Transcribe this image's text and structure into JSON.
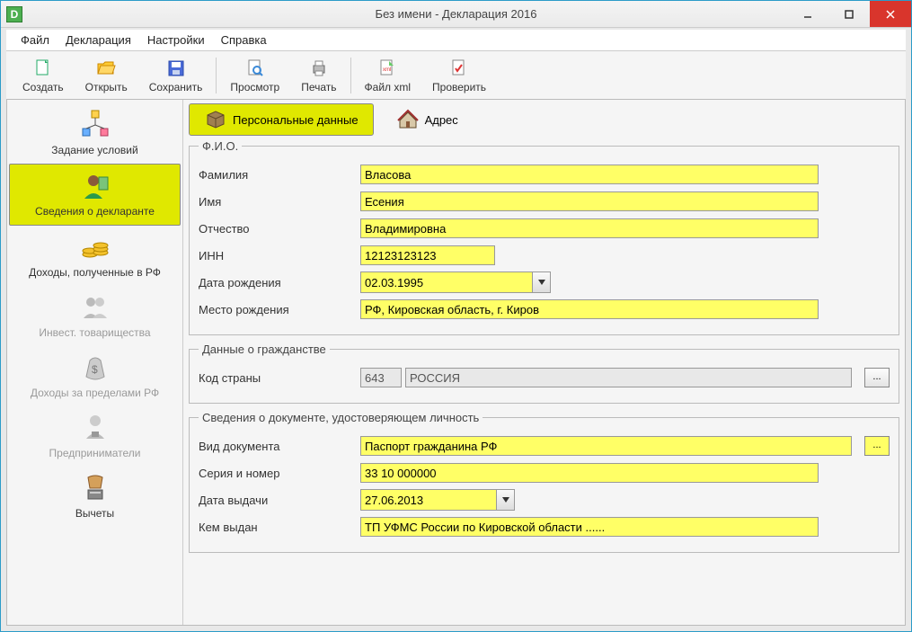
{
  "window": {
    "title": "Без имени - Декларация 2016",
    "app_icon_letter": "D"
  },
  "menu": {
    "file": "Файл",
    "declaration": "Декларация",
    "settings": "Настройки",
    "help": "Справка"
  },
  "toolbar": {
    "create": "Создать",
    "open": "Открыть",
    "save": "Сохранить",
    "preview": "Просмотр",
    "print": "Печать",
    "file_xml": "Файл xml",
    "check": "Проверить"
  },
  "sidebar": {
    "items": [
      {
        "label": "Задание условий",
        "active": false,
        "disabled": false
      },
      {
        "label": "Сведения о декларанте",
        "active": true,
        "disabled": false
      },
      {
        "label": "Доходы, полученные в РФ",
        "active": false,
        "disabled": false
      },
      {
        "label": "Инвест. товарищества",
        "active": false,
        "disabled": true
      },
      {
        "label": "Доходы за пределами РФ",
        "active": false,
        "disabled": true
      },
      {
        "label": "Предприниматели",
        "active": false,
        "disabled": true
      },
      {
        "label": "Вычеты",
        "active": false,
        "disabled": false
      }
    ]
  },
  "tabs": {
    "personal": "Персональные данные",
    "address": "Адрес"
  },
  "fio": {
    "legend": "Ф.И.О.",
    "surname_label": "Фамилия",
    "surname": "Власова",
    "name_label": "Имя",
    "name": "Есения",
    "patronymic_label": "Отчество",
    "patronymic": "Владимировна",
    "inn_label": "ИНН",
    "inn": "12123123123",
    "dob_label": "Дата рождения",
    "dob": "02.03.1995",
    "pob_label": "Место рождения",
    "pob": "РФ, Кировская область, г. Киров"
  },
  "citizenship": {
    "legend": "Данные о гражданстве",
    "code_label": "Код страны",
    "code": "643",
    "country": "РОССИЯ",
    "browse": "..."
  },
  "document": {
    "legend": "Сведения о документе, удостоверяющем личность",
    "type_label": "Вид документа",
    "type": "Паспорт гражданина РФ",
    "browse": "...",
    "series_label": "Серия и номер",
    "series": "33 10 000000",
    "issue_date_label": "Дата выдачи",
    "issue_date": "27.06.2013",
    "issued_by_label": "Кем выдан",
    "issued_by": "ТП УФМС России по Кировской области ......"
  }
}
